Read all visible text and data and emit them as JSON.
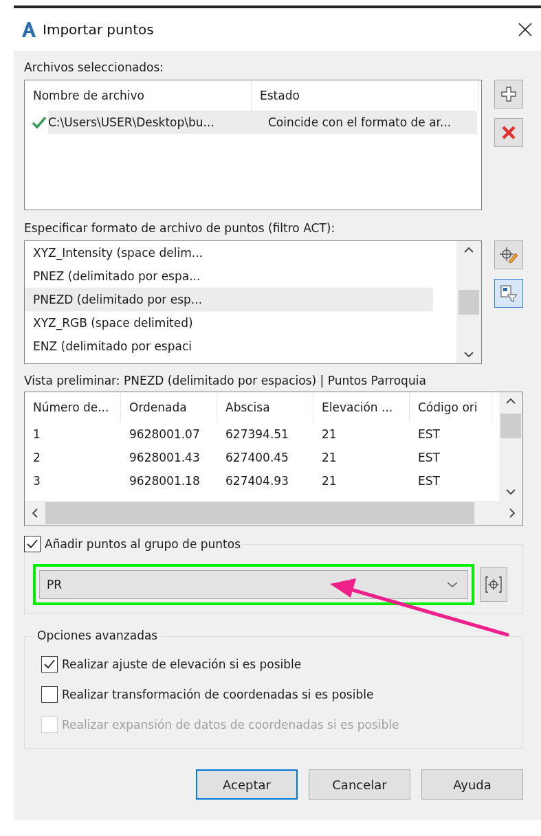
{
  "window": {
    "title": "Importar puntos"
  },
  "files": {
    "label": "Archivos seleccionados:",
    "columns": [
      "Nombre de archivo",
      "Estado"
    ],
    "rows": [
      {
        "cells": [
          "C:\\Users\\USER\\Desktop\\bu...",
          "Coincide con el formato de ar..."
        ],
        "valid": true,
        "selected": true
      }
    ]
  },
  "formats": {
    "label": "Especificar formato de archivo de puntos (filtro ACT):",
    "items": [
      {
        "label": "XYZ_Intensity (space delim...",
        "selected": false
      },
      {
        "label": "PNEZ (delimitado por espa...",
        "selected": false
      },
      {
        "label": "PNEZD (delimitado por esp...",
        "selected": true
      },
      {
        "label": "XYZ_RGB (space delimited)",
        "selected": false
      },
      {
        "label": "ENZ (delimitado por espaci",
        "selected": false
      }
    ]
  },
  "preview": {
    "label": "Vista preliminar: PNEZD (delimitado por espacios) | Puntos Parroquia",
    "columns": [
      "Número de...",
      "Ordenada",
      "Abscisa",
      "Elevación ...",
      "Código ori"
    ],
    "rows": [
      [
        "1",
        "9628001.07",
        "627394.51",
        "21",
        "EST"
      ],
      [
        "2",
        "9628001.43",
        "627400.45",
        "21",
        "EST"
      ],
      [
        "3",
        "9628001.18",
        "627404.93",
        "21",
        "EST"
      ]
    ]
  },
  "point_group": {
    "label": "Añadir puntos al grupo de puntos",
    "checked": true,
    "value": "PR",
    "highlighted": true
  },
  "advanced": {
    "title": "Opciones avanzadas",
    "options": [
      {
        "label": "Realizar ajuste de elevación si es posible",
        "checked": true,
        "disabled": false
      },
      {
        "label": "Realizar transformación de coordenadas si es posible",
        "checked": false,
        "disabled": false
      },
      {
        "label": "Realizar expansión de datos de coordenadas si es posible",
        "checked": false,
        "disabled": true
      }
    ]
  },
  "buttons": [
    {
      "label": "Aceptar",
      "default": true
    },
    {
      "label": "Cancelar",
      "default": false
    },
    {
      "label": "Ayuda",
      "default": false
    }
  ]
}
